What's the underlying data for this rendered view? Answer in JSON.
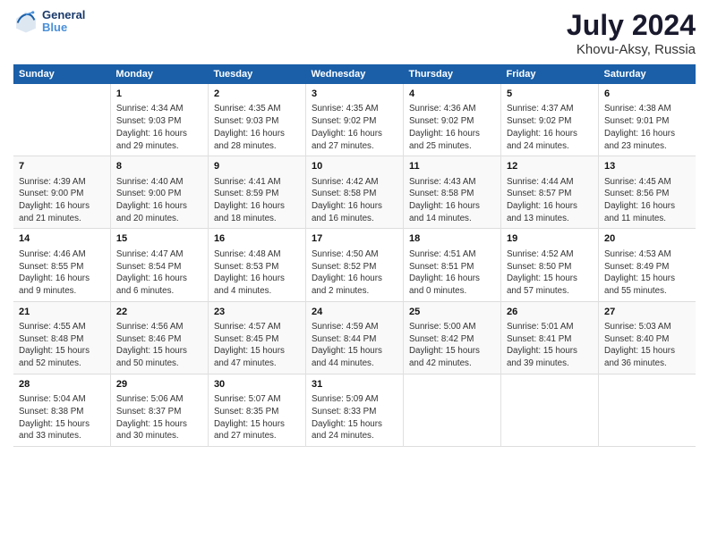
{
  "header": {
    "logo_line1": "General",
    "logo_line2": "Blue",
    "title": "July 2024",
    "subtitle": "Khovu-Aksy, Russia"
  },
  "columns": [
    "Sunday",
    "Monday",
    "Tuesday",
    "Wednesday",
    "Thursday",
    "Friday",
    "Saturday"
  ],
  "weeks": [
    [
      {
        "day": "",
        "lines": []
      },
      {
        "day": "1",
        "lines": [
          "Sunrise: 4:34 AM",
          "Sunset: 9:03 PM",
          "Daylight: 16 hours",
          "and 29 minutes."
        ]
      },
      {
        "day": "2",
        "lines": [
          "Sunrise: 4:35 AM",
          "Sunset: 9:03 PM",
          "Daylight: 16 hours",
          "and 28 minutes."
        ]
      },
      {
        "day": "3",
        "lines": [
          "Sunrise: 4:35 AM",
          "Sunset: 9:02 PM",
          "Daylight: 16 hours",
          "and 27 minutes."
        ]
      },
      {
        "day": "4",
        "lines": [
          "Sunrise: 4:36 AM",
          "Sunset: 9:02 PM",
          "Daylight: 16 hours",
          "and 25 minutes."
        ]
      },
      {
        "day": "5",
        "lines": [
          "Sunrise: 4:37 AM",
          "Sunset: 9:02 PM",
          "Daylight: 16 hours",
          "and 24 minutes."
        ]
      },
      {
        "day": "6",
        "lines": [
          "Sunrise: 4:38 AM",
          "Sunset: 9:01 PM",
          "Daylight: 16 hours",
          "and 23 minutes."
        ]
      }
    ],
    [
      {
        "day": "7",
        "lines": [
          "Sunrise: 4:39 AM",
          "Sunset: 9:00 PM",
          "Daylight: 16 hours",
          "and 21 minutes."
        ]
      },
      {
        "day": "8",
        "lines": [
          "Sunrise: 4:40 AM",
          "Sunset: 9:00 PM",
          "Daylight: 16 hours",
          "and 20 minutes."
        ]
      },
      {
        "day": "9",
        "lines": [
          "Sunrise: 4:41 AM",
          "Sunset: 8:59 PM",
          "Daylight: 16 hours",
          "and 18 minutes."
        ]
      },
      {
        "day": "10",
        "lines": [
          "Sunrise: 4:42 AM",
          "Sunset: 8:58 PM",
          "Daylight: 16 hours",
          "and 16 minutes."
        ]
      },
      {
        "day": "11",
        "lines": [
          "Sunrise: 4:43 AM",
          "Sunset: 8:58 PM",
          "Daylight: 16 hours",
          "and 14 minutes."
        ]
      },
      {
        "day": "12",
        "lines": [
          "Sunrise: 4:44 AM",
          "Sunset: 8:57 PM",
          "Daylight: 16 hours",
          "and 13 minutes."
        ]
      },
      {
        "day": "13",
        "lines": [
          "Sunrise: 4:45 AM",
          "Sunset: 8:56 PM",
          "Daylight: 16 hours",
          "and 11 minutes."
        ]
      }
    ],
    [
      {
        "day": "14",
        "lines": [
          "Sunrise: 4:46 AM",
          "Sunset: 8:55 PM",
          "Daylight: 16 hours",
          "and 9 minutes."
        ]
      },
      {
        "day": "15",
        "lines": [
          "Sunrise: 4:47 AM",
          "Sunset: 8:54 PM",
          "Daylight: 16 hours",
          "and 6 minutes."
        ]
      },
      {
        "day": "16",
        "lines": [
          "Sunrise: 4:48 AM",
          "Sunset: 8:53 PM",
          "Daylight: 16 hours",
          "and 4 minutes."
        ]
      },
      {
        "day": "17",
        "lines": [
          "Sunrise: 4:50 AM",
          "Sunset: 8:52 PM",
          "Daylight: 16 hours",
          "and 2 minutes."
        ]
      },
      {
        "day": "18",
        "lines": [
          "Sunrise: 4:51 AM",
          "Sunset: 8:51 PM",
          "Daylight: 16 hours",
          "and 0 minutes."
        ]
      },
      {
        "day": "19",
        "lines": [
          "Sunrise: 4:52 AM",
          "Sunset: 8:50 PM",
          "Daylight: 15 hours",
          "and 57 minutes."
        ]
      },
      {
        "day": "20",
        "lines": [
          "Sunrise: 4:53 AM",
          "Sunset: 8:49 PM",
          "Daylight: 15 hours",
          "and 55 minutes."
        ]
      }
    ],
    [
      {
        "day": "21",
        "lines": [
          "Sunrise: 4:55 AM",
          "Sunset: 8:48 PM",
          "Daylight: 15 hours",
          "and 52 minutes."
        ]
      },
      {
        "day": "22",
        "lines": [
          "Sunrise: 4:56 AM",
          "Sunset: 8:46 PM",
          "Daylight: 15 hours",
          "and 50 minutes."
        ]
      },
      {
        "day": "23",
        "lines": [
          "Sunrise: 4:57 AM",
          "Sunset: 8:45 PM",
          "Daylight: 15 hours",
          "and 47 minutes."
        ]
      },
      {
        "day": "24",
        "lines": [
          "Sunrise: 4:59 AM",
          "Sunset: 8:44 PM",
          "Daylight: 15 hours",
          "and 44 minutes."
        ]
      },
      {
        "day": "25",
        "lines": [
          "Sunrise: 5:00 AM",
          "Sunset: 8:42 PM",
          "Daylight: 15 hours",
          "and 42 minutes."
        ]
      },
      {
        "day": "26",
        "lines": [
          "Sunrise: 5:01 AM",
          "Sunset: 8:41 PM",
          "Daylight: 15 hours",
          "and 39 minutes."
        ]
      },
      {
        "day": "27",
        "lines": [
          "Sunrise: 5:03 AM",
          "Sunset: 8:40 PM",
          "Daylight: 15 hours",
          "and 36 minutes."
        ]
      }
    ],
    [
      {
        "day": "28",
        "lines": [
          "Sunrise: 5:04 AM",
          "Sunset: 8:38 PM",
          "Daylight: 15 hours",
          "and 33 minutes."
        ]
      },
      {
        "day": "29",
        "lines": [
          "Sunrise: 5:06 AM",
          "Sunset: 8:37 PM",
          "Daylight: 15 hours",
          "and 30 minutes."
        ]
      },
      {
        "day": "30",
        "lines": [
          "Sunrise: 5:07 AM",
          "Sunset: 8:35 PM",
          "Daylight: 15 hours",
          "and 27 minutes."
        ]
      },
      {
        "day": "31",
        "lines": [
          "Sunrise: 5:09 AM",
          "Sunset: 8:33 PM",
          "Daylight: 15 hours",
          "and 24 minutes."
        ]
      },
      {
        "day": "",
        "lines": []
      },
      {
        "day": "",
        "lines": []
      },
      {
        "day": "",
        "lines": []
      }
    ]
  ]
}
